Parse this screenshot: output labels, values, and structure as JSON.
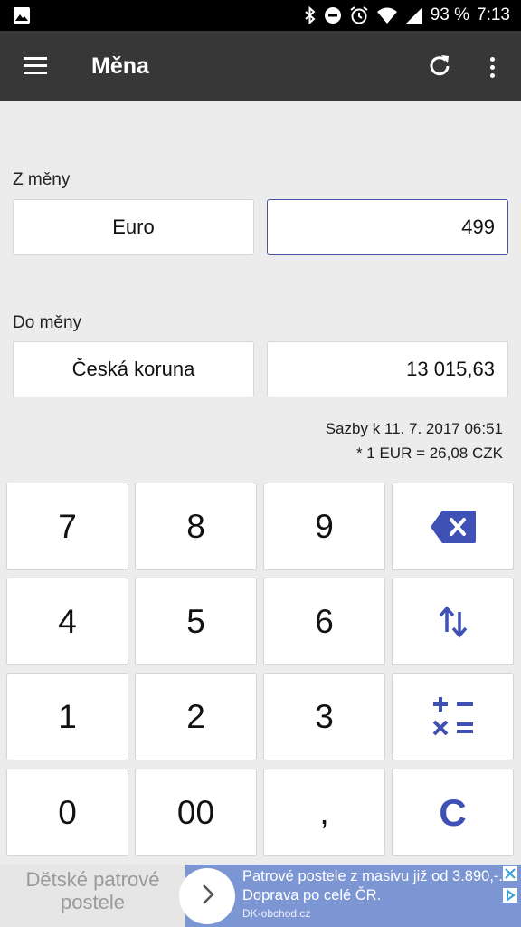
{
  "status_bar": {
    "battery": "93 %",
    "time": "7:13"
  },
  "app_bar": {
    "title": "Měna"
  },
  "converter": {
    "from_label": "Z měny",
    "from_currency": "Euro",
    "from_amount": "499",
    "to_label": "Do měny",
    "to_currency": "Česká koruna",
    "to_amount": "13 015,63",
    "rates_date": "Sazby k 11. 7. 2017 06:51",
    "rate": "* 1 EUR = 26,08 CZK"
  },
  "keypad": {
    "keys": [
      "7",
      "8",
      "9",
      "4",
      "5",
      "6",
      "1",
      "2",
      "3",
      "0",
      "00",
      ","
    ],
    "clear": "C"
  },
  "ad": {
    "left_text": "Dětské patrové postele",
    "text": "Patrové postele z masivu již od 3.890,-. Doprava po celé ČR.",
    "domain": "DK-obchod.cz"
  },
  "colors": {
    "accent": "#3f51b5",
    "appbar": "#373737",
    "background": "#ececec",
    "ad_background": "#7c96d4"
  }
}
